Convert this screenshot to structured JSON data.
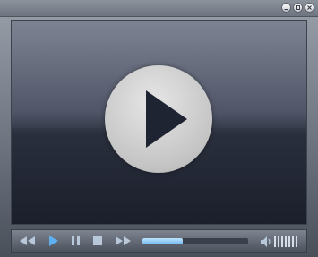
{
  "window": {
    "controls": [
      "minimize-icon",
      "maximize-icon",
      "close-icon"
    ]
  },
  "video": {
    "overlay_icon": "play-icon"
  },
  "controls": {
    "buttons": [
      "rewind-icon",
      "play-icon",
      "pause-icon",
      "stop-icon",
      "fast-forward-icon"
    ],
    "seek_progress": 0.38,
    "volume_icon": "speaker-icon",
    "volume_level": 1.0
  },
  "colors": {
    "accent": "#6fb6ee",
    "play_button": "#d0d0d0",
    "play_triangle": "#1f2433"
  }
}
